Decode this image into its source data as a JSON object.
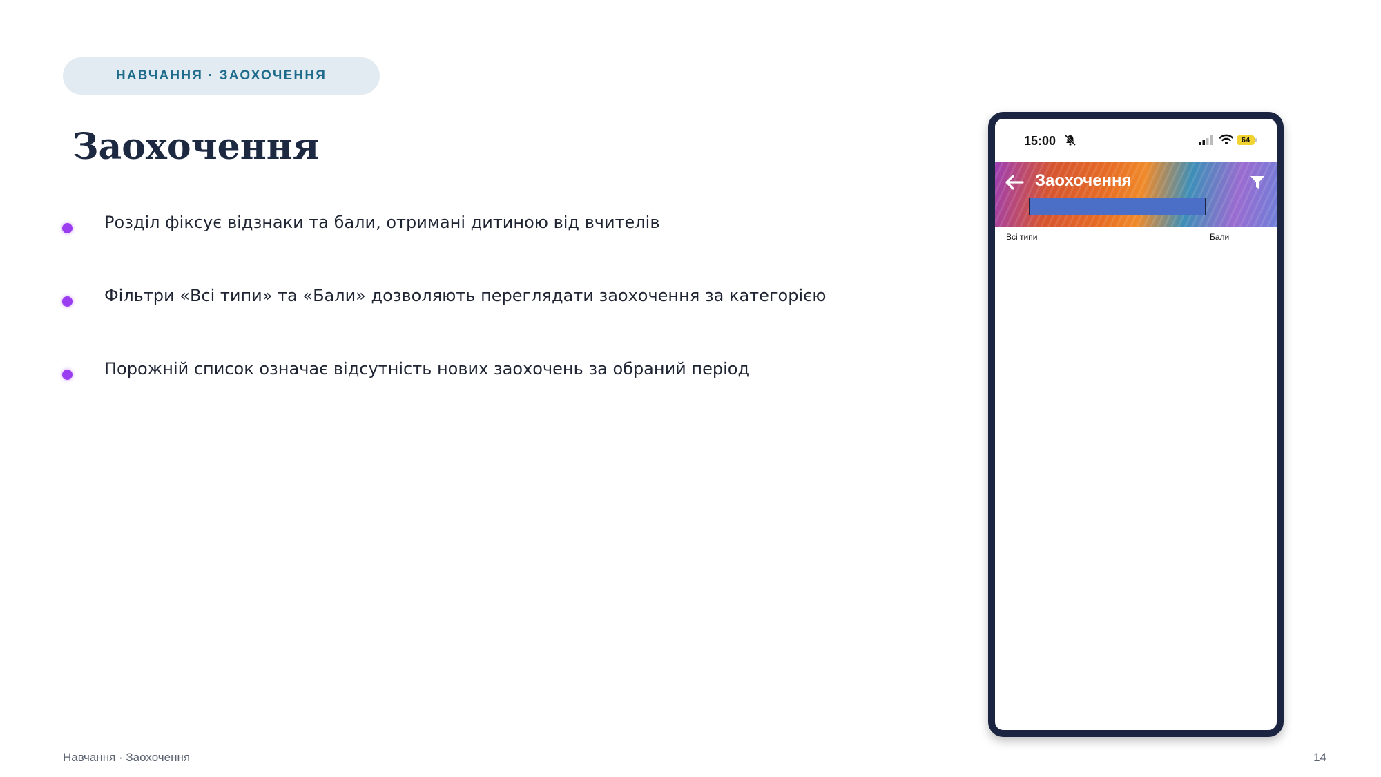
{
  "badge": "НАВЧАННЯ · ЗАОХОЧЕННЯ",
  "title": "Заохочення",
  "bullets": [
    "Розділ фіксує відзнаки та бали, отримані дитиною від вчителів",
    "Фільтри «Всі типи» та «Бали» дозволяють переглядати заохочення за категорією",
    "Порожній список означає відсутність нових заохочень за обраний період"
  ],
  "footer": {
    "left": "Навчання · Заохочення",
    "page_number": "14"
  },
  "phone": {
    "status_time": "15:00",
    "battery": "64",
    "app_title": "Заохочення",
    "filters": [
      "Всі типи",
      "Бали"
    ]
  },
  "colors": {
    "accent_purple": "#9a3cf0",
    "title_navy": "#1c2940",
    "badge_bg": "#e2ebf2",
    "badge_text": "#1e6a8a",
    "phone_frame": "#1b2440",
    "redaction_blue": "#4b6fc6"
  },
  "icons": [
    "bell-off-icon",
    "signal-icon",
    "wifi-icon",
    "battery-icon",
    "back-arrow-icon",
    "filter-icon"
  ]
}
